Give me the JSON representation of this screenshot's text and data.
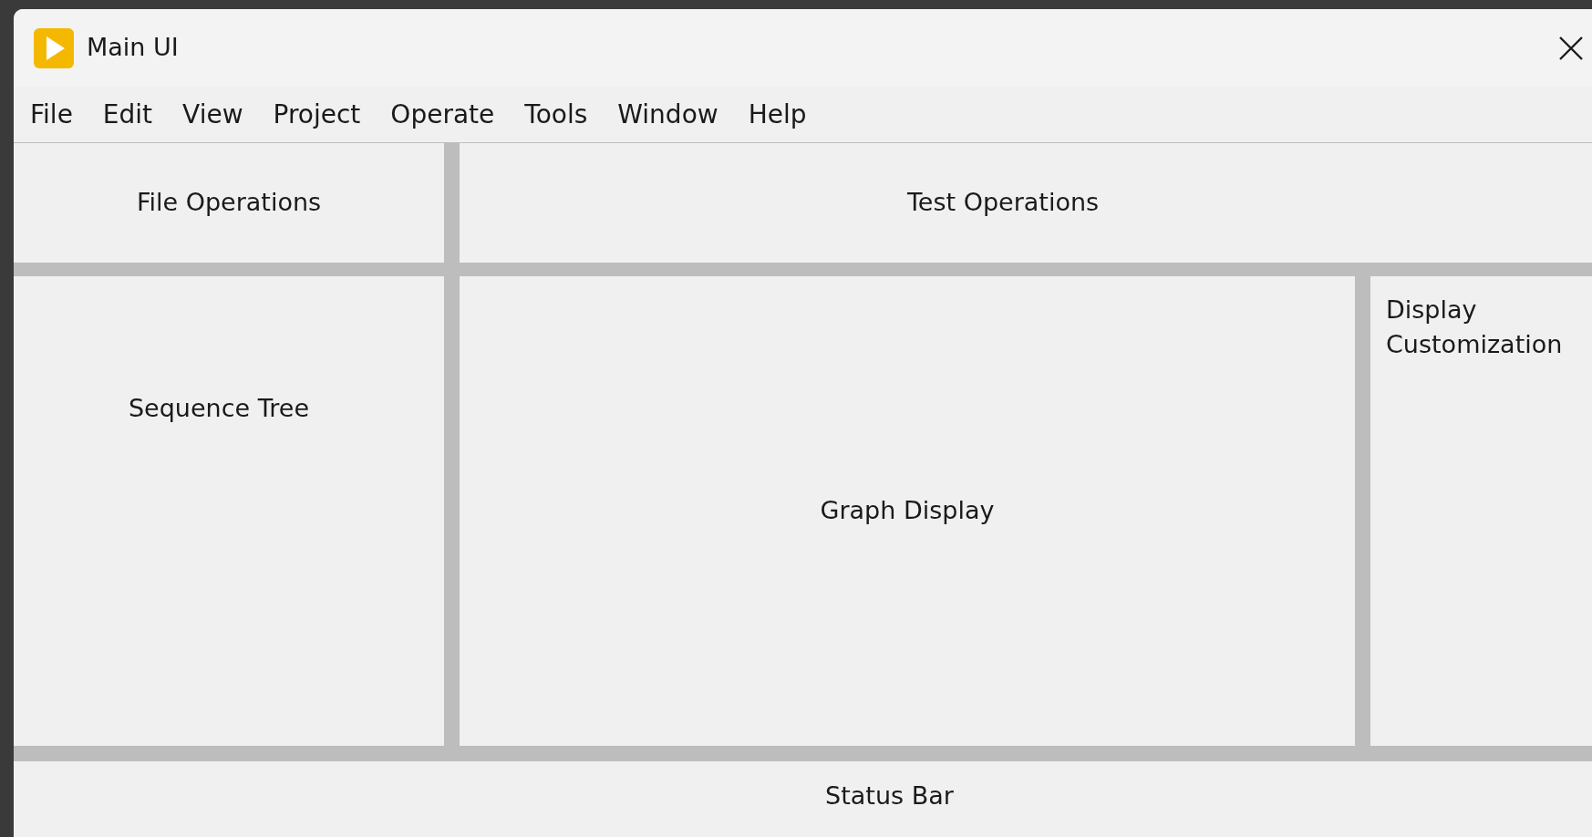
{
  "window": {
    "title": "Main UI"
  },
  "menu": [
    "File",
    "Edit",
    "View",
    "Project",
    "Operate",
    "Tools",
    "Window",
    "Help"
  ],
  "panels": {
    "file_operations": "File Operations",
    "test_operations": "Test Operations",
    "sequence_tree": "Sequence Tree",
    "graph_display": "Graph Display",
    "display_customization": "Display Customization",
    "status_bar": "Status Bar"
  }
}
